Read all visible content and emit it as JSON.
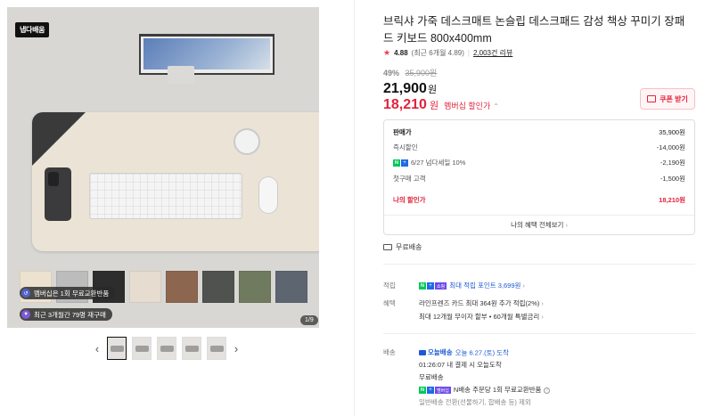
{
  "gallery": {
    "brand_badge": "냅다배움",
    "badges": [
      "멤버십은 1회 무료교환반품",
      "최근 3개월간 79명 재구매"
    ],
    "page_counter": "1/9",
    "swatch_colors": [
      "#ece2cf",
      "#bcbcbc",
      "#2d2d2d",
      "#e6ddd0",
      "#8d6650",
      "#505250",
      "#707a5f",
      "#5d6670"
    ],
    "thumb_count": 5
  },
  "product": {
    "title": "브릭샤 가죽 데스크매트 논슬립 데스크패드 감성 책상 꾸미기 장패드 키보드 800x400mm",
    "rating": "4.88",
    "rating_detail": "(최근 6개월 4.89",
    "review_count": "2,003건 리뷰",
    "discount_rate": "49%",
    "original_price": "35,900원",
    "price": "21,900",
    "price_unit": "원",
    "member_price": "18,210",
    "member_unit": "원",
    "member_label": "멤버십 할인가",
    "coupon_label": "쿠폰 받기"
  },
  "breakdown": {
    "rows": [
      {
        "label": "판매가",
        "value": "35,900원"
      },
      {
        "label": "즉시할인",
        "value": "-14,000원"
      },
      {
        "label": "6/27 넘다세일 10%",
        "value": "-2,190원"
      },
      {
        "label": "첫구매 고객",
        "value": "-1,500원"
      },
      {
        "label": "나의 할인가",
        "value": "18,210원"
      }
    ],
    "benefit_link": "나의 혜택 전체보기"
  },
  "shipping": {
    "free_label": "무료배송"
  },
  "info": {
    "point_label": "적립",
    "point_text": "최대 적립 포인트 3,699원",
    "benefit_label": "혜택",
    "benefit_line1": "라인프렌즈 카드 최대 364원 추가 적립(2%)",
    "benefit_line2": "최대 12개월 무이자 할부 • 60개월 특별금리",
    "delivery_label": "배송",
    "today_label": "오늘배송",
    "delivery_date": "오늘 6.27.(토) 도착",
    "delivery_cutoff": "01:26:07  내 결제 시 오늘도착",
    "delivery_fee": "무료배송",
    "delivery_return": "N배송 주문당 1회 무료교환반품",
    "delivery_note": "일반배송 전환(선물하기, 합배송 등) 제외"
  },
  "colors": {
    "accent": "#e2233c",
    "naver_green": "#03c75a",
    "link_blue": "#1e5ad6"
  }
}
